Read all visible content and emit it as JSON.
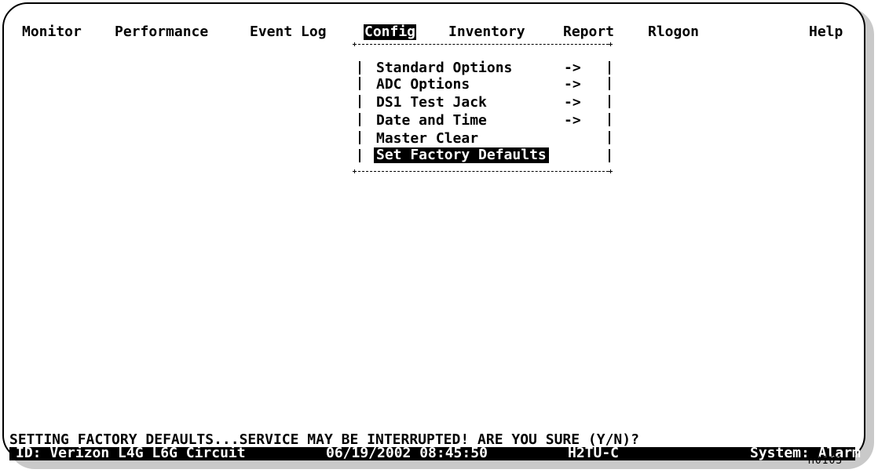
{
  "menu": {
    "items": [
      {
        "label": "Monitor"
      },
      {
        "label": "Performance"
      },
      {
        "label": "Event Log"
      },
      {
        "label": "Config",
        "active": true
      },
      {
        "label": "Inventory"
      },
      {
        "label": "Report"
      },
      {
        "label": "Rlogon"
      },
      {
        "label": "Help"
      }
    ]
  },
  "config_menu": {
    "items": [
      {
        "label": "Standard Options",
        "arrow": "->"
      },
      {
        "label": "ADC Options",
        "arrow": "->"
      },
      {
        "label": "DS1 Test Jack",
        "arrow": "->"
      },
      {
        "label": "Date and Time",
        "arrow": "->"
      },
      {
        "label": "Master Clear",
        "arrow": ""
      },
      {
        "label": "Set Factory Defaults",
        "arrow": "",
        "selected": true
      }
    ]
  },
  "prompt": "SETTING FACTORY DEFAULTS...SERVICE MAY BE INTERRUPTED! ARE YOU SURE (Y/N)?",
  "status_bar": {
    "id": "ID: Verizon L4G L6G Circuit",
    "datetime": "06/19/2002 08:45:50",
    "unit": "H2TU-C",
    "system": "System: Alarm"
  },
  "figure_code": "H0103"
}
